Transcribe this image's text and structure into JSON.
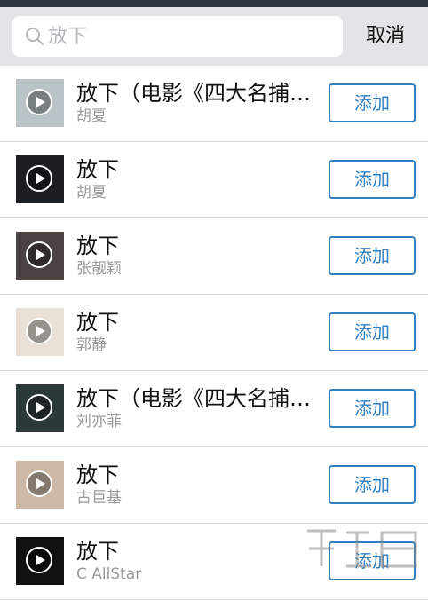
{
  "search": {
    "query": "放下",
    "cancel_label": "取消"
  },
  "results": [
    {
      "title": "放下（电影《四大名捕2...",
      "artist": "胡夏",
      "add_label": "添加",
      "cover_color": "#b9c3c8"
    },
    {
      "title": "放下",
      "artist": "胡夏",
      "add_label": "添加",
      "cover_color": "#1b1f22"
    },
    {
      "title": "放下",
      "artist": "张靓颖",
      "add_label": "添加",
      "cover_color": "#4a4341"
    },
    {
      "title": "放下",
      "artist": "郭静",
      "add_label": "添加",
      "cover_color": "#e9e1d7"
    },
    {
      "title": "放下（电影《四大名捕2...",
      "artist": "刘亦菲",
      "add_label": "添加",
      "cover_color": "#2b3a38"
    },
    {
      "title": "放下",
      "artist": "古巨基",
      "add_label": "添加",
      "cover_color": "#cdb8a6"
    },
    {
      "title": "放下",
      "artist": "C AllStar",
      "add_label": "添加",
      "cover_color": "#111111"
    }
  ],
  "colors": {
    "accent": "#2f7fc1",
    "topbar": "#2f3642",
    "search_bg": "#e4e4e6"
  },
  "icons": {
    "search": "search-icon",
    "play": "play-icon"
  }
}
